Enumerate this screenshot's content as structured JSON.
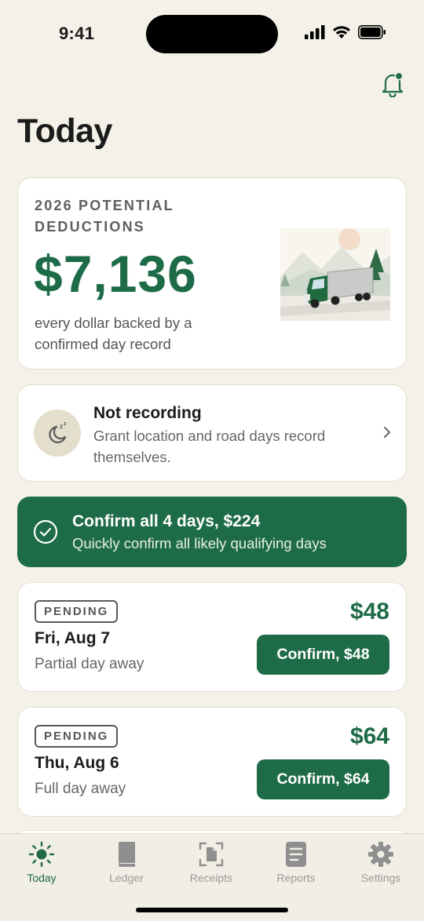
{
  "status_bar": {
    "time": "9:41"
  },
  "header": {
    "title": "Today",
    "bell_icon": "bell-icon"
  },
  "deductions": {
    "label": "2026 POTENTIAL DEDUCTIONS",
    "amount": "$7,136",
    "note": "every dollar backed by a confirmed day record",
    "accent_color": "#1e6b47"
  },
  "recording": {
    "icon": "sleep-moon-icon",
    "title": "Not recording",
    "subtitle": "Grant location and road days record themselves."
  },
  "confirm_all": {
    "title": "Confirm all 4 days, $224",
    "subtitle": "Quickly confirm all likely qualifying days"
  },
  "days": [
    {
      "badge": "PENDING",
      "date": "Fri, Aug 7",
      "desc": "Partial day away",
      "amount": "$48",
      "button": "Confirm, $48"
    },
    {
      "badge": "PENDING",
      "date": "Thu, Aug 6",
      "desc": "Full day away",
      "amount": "$64",
      "button": "Confirm, $64"
    }
  ],
  "tabs": [
    {
      "label": "Today",
      "icon": "sun-icon",
      "active": true
    },
    {
      "label": "Ledger",
      "icon": "book-icon",
      "active": false
    },
    {
      "label": "Receipts",
      "icon": "receipt-scan-icon",
      "active": false
    },
    {
      "label": "Reports",
      "icon": "document-icon",
      "active": false
    },
    {
      "label": "Settings",
      "icon": "gear-icon",
      "active": false
    }
  ]
}
